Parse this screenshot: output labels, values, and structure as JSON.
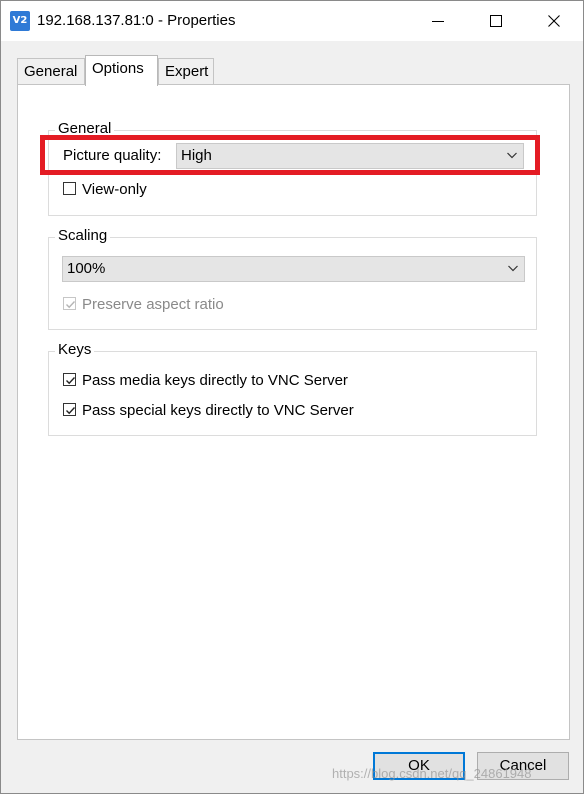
{
  "window": {
    "title": "192.168.137.81:0 - Properties",
    "app_icon_text": "V2"
  },
  "tabs": [
    {
      "label": "General"
    },
    {
      "label": "Options"
    },
    {
      "label": "Expert"
    }
  ],
  "options": {
    "general": {
      "legend": "General",
      "picture_quality_label": "Picture quality:",
      "picture_quality_value": "High",
      "view_only_label": "View-only",
      "view_only_checked": false
    },
    "scaling": {
      "legend": "Scaling",
      "scaling_value": "100%",
      "preserve_aspect_label": "Preserve aspect ratio",
      "preserve_aspect_checked": true,
      "preserve_aspect_enabled": false
    },
    "keys": {
      "legend": "Keys",
      "media_keys_label": "Pass media keys directly to VNC Server",
      "media_keys_checked": true,
      "special_keys_label": "Pass special keys directly to VNC Server",
      "special_keys_checked": true
    }
  },
  "buttons": {
    "ok": "OK",
    "cancel": "Cancel"
  },
  "watermark": "https://blog.csdn.net/qq_24861948",
  "colors": {
    "highlight": "#e41c24",
    "ok_border": "#0078d7"
  }
}
